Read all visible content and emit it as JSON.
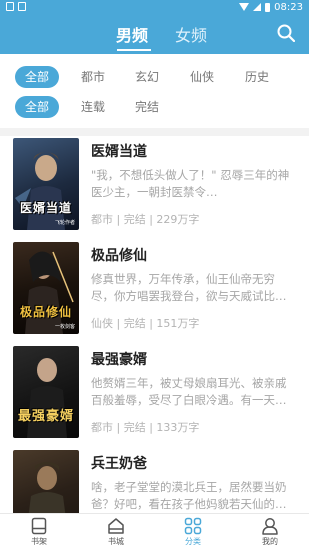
{
  "statusbar": {
    "time": "08:23"
  },
  "nav": {
    "tabs": [
      {
        "label": "男频"
      },
      {
        "label": "女频"
      }
    ]
  },
  "filters": {
    "row1": [
      "全部",
      "都市",
      "玄幻",
      "仙侠",
      "历史"
    ],
    "row2": [
      "全部",
      "连载",
      "完结"
    ]
  },
  "books": [
    {
      "title": "医婿当道",
      "desc": "\"我，不想低头做人了！\" 忍辱三年的神医少主，一朝封医禁令…",
      "meta": "都市 | 完结 | 229万字",
      "cover_text": "医婿当道",
      "cover_author": "飞轮作者"
    },
    {
      "title": "极品修仙",
      "desc": "修真世界，万年传承，仙王仙帝无穷尽，你方唱罢我登台，欲与天威试比…",
      "meta": "仙侠 | 完结 | 151万字",
      "cover_text": "极品修仙",
      "cover_author": "一枚剑客"
    },
    {
      "title": "最强豪婿",
      "desc": "他赘婿三年，被丈母娘扇耳光、被亲戚百般羞辱，受尽了白眼冷遇。有一天…",
      "meta": "都市 | 完结 | 133万字",
      "cover_text": "最强豪婿",
      "cover_author": ""
    },
    {
      "title": "兵王奶爸",
      "desc": "啥，老子堂堂的漠北兵王，居然要当奶爸？好吧，看在孩子他妈貌若天仙的…",
      "meta": "",
      "cover_text": "",
      "cover_author": ""
    }
  ],
  "tabbar": [
    {
      "label": "书架",
      "icon": "bookshelf-icon"
    },
    {
      "label": "书城",
      "icon": "bookstore-icon"
    },
    {
      "label": "分类",
      "icon": "category-icon"
    },
    {
      "label": "我的",
      "icon": "profile-icon"
    }
  ],
  "colors": {
    "accent": "#4aa8d8"
  }
}
